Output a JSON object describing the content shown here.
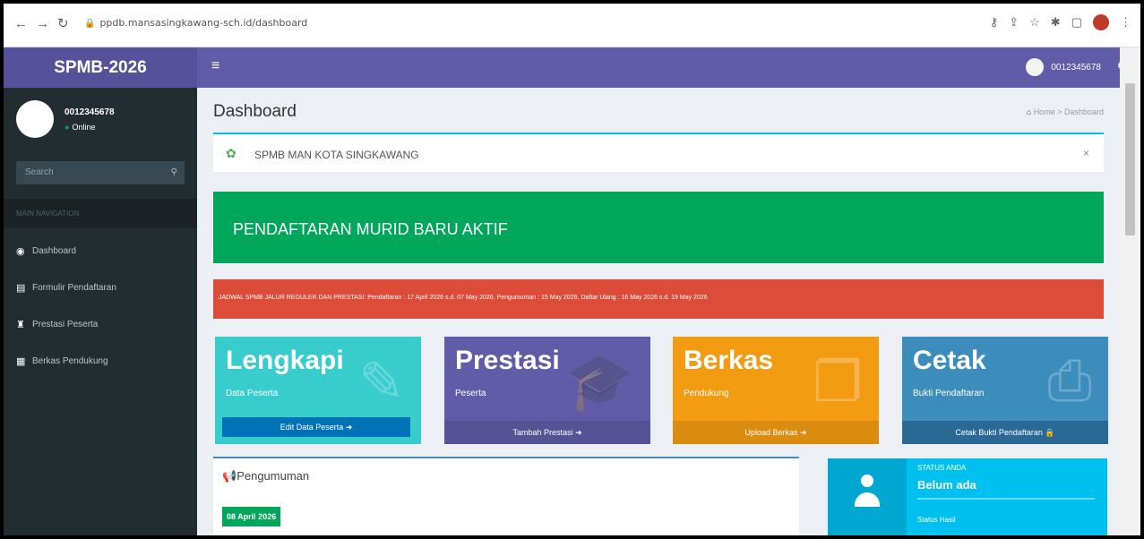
{
  "browser": {
    "url": "ppdb.mansasingkawang-sch.id/dashboard"
  },
  "app": {
    "logo": "SPMB-2026",
    "user_id": "0012345678"
  },
  "sidebar": {
    "user_name": "0012345678",
    "user_status": "Online",
    "search_placeholder": "Search",
    "section": "MAIN NAVIGATION",
    "items": [
      {
        "label": "Dashboard",
        "icon": "dashboard-icon"
      },
      {
        "label": "Formulir Pendaftaran",
        "icon": "file-icon"
      },
      {
        "label": "Prestasi Peserta",
        "icon": "trophy-icon"
      },
      {
        "label": "Berkas Pendukung",
        "icon": "files-icon"
      }
    ]
  },
  "content": {
    "title": "Dashboard",
    "breadcrumb": {
      "home": "Home",
      "current": "Dashboard"
    },
    "notice": "SPMB MAN KOTA SINGKAWANG",
    "banner": "PENDAFTARAN MURID BARU AKTIF",
    "schedule": "JADWAL SPMB JALUR REGULER DAN PRESTASI: Pendaftaran : 17 April 2026 s.d. 07 May 2026, Pengumuman : 15 May 2026, Daftar Ulang : 16 May 2026 s.d. 19 May 2026",
    "boxes": [
      {
        "title": "Lengkapi",
        "sub": "Data Peserta",
        "action": "Edit Data Peserta"
      },
      {
        "title": "Prestasi",
        "sub": "Peserta",
        "action": "Tambah Prestasi"
      },
      {
        "title": "Berkas",
        "sub": "Pendukung",
        "action": "Upload Berkas"
      },
      {
        "title": "Cetak",
        "sub": "Bukti Pendaftaran",
        "action": "Cetak Bukti Pendaftaran"
      }
    ],
    "announcement": {
      "title": "Pengumuman",
      "date": "08 April 2026"
    },
    "status": {
      "label": "STATUS ANDA",
      "value": "Belum ada",
      "footer": "Status Hasil"
    }
  },
  "colors": {
    "header": "#605ca8",
    "sidebar": "#222d32",
    "green": "#00a65a",
    "red": "#dd4b39",
    "teal": "#39cccc",
    "orange": "#f39c12",
    "blue": "#3c8dbc",
    "aqua": "#00c0ef"
  }
}
